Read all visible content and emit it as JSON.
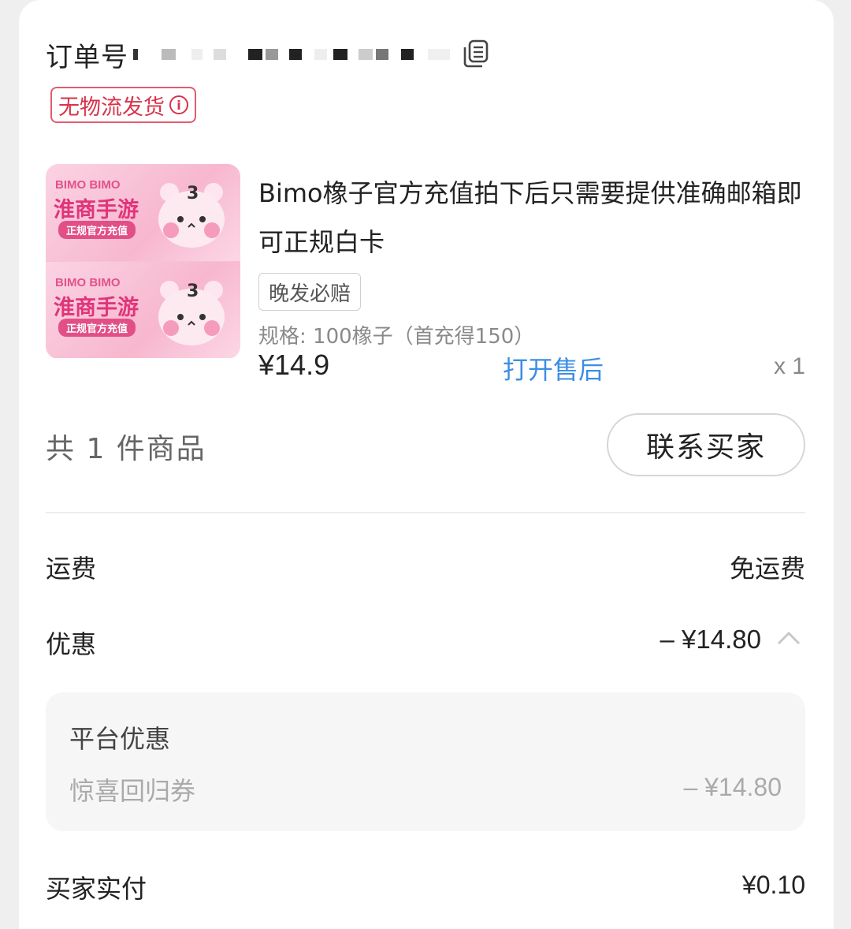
{
  "order": {
    "label": "订单号"
  },
  "tags": {
    "no_logistics": "无物流发货",
    "late_compensation": "晚发必赔"
  },
  "product": {
    "thumbnail": {
      "brand": "BIMO BIMO",
      "title": "淮商手游",
      "subtitle": "正规官方充值",
      "badge": "3"
    },
    "title": "Bimo橡子官方充值拍下后只需要提供准确邮箱即可正规白卡",
    "spec": "规格: 100橡子（首充得150）",
    "price": "¥14.9",
    "after_sale_link": "打开售后",
    "quantity": "x 1"
  },
  "summary": {
    "total_items": "共 1 件商品",
    "contact_button": "联系买家"
  },
  "fees": {
    "shipping_label": "运费",
    "shipping_value": "免运费",
    "discount_label": "优惠",
    "discount_value": "– ¥14.80",
    "platform_discount": {
      "title": "平台优惠",
      "coupon_name": "惊喜回归券",
      "coupon_value": "– ¥14.80"
    },
    "paid_label": "买家实付",
    "paid_value": "¥0.10"
  },
  "colors": {
    "accent_red": "#d8334b",
    "link_blue": "#3b8ee5",
    "thumb_pink": "#f7b7cf"
  }
}
